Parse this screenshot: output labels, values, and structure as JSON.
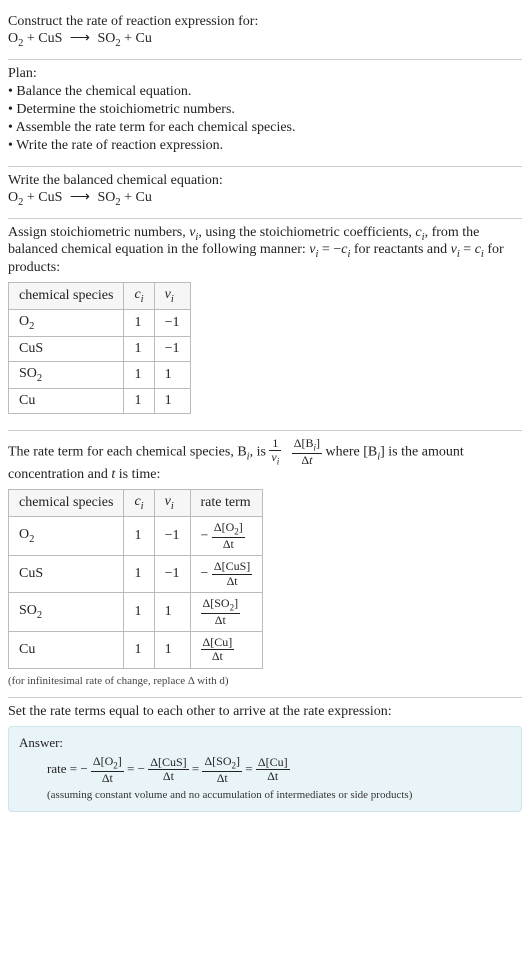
{
  "intro": {
    "construct": "Construct the rate of reaction expression for:",
    "eq_lhs_1": "O",
    "eq_lhs_1_sub": "2",
    "plus": " + ",
    "eq_lhs_2": "CuS",
    "arrow": "⟶",
    "eq_rhs_1": "SO",
    "eq_rhs_1_sub": "2",
    "eq_rhs_2": "Cu"
  },
  "plan": {
    "title": "Plan:",
    "b1": "• Balance the chemical equation.",
    "b2": "• Determine the stoichiometric numbers.",
    "b3": "• Assemble the rate term for each chemical species.",
    "b4": "• Write the rate of reaction expression."
  },
  "balanced": {
    "title": "Write the balanced chemical equation:"
  },
  "assign": {
    "text1": "Assign stoichiometric numbers, ",
    "nu_i": "ν",
    "text2": ", using the stoichiometric coefficients, ",
    "c_i": "c",
    "text3": ", from the balanced chemical equation in the following manner: ",
    "rel1a": "ν",
    "rel1b": " = −",
    "rel1c": "c",
    "text4": " for reactants and ",
    "rel2a": "ν",
    "rel2b": " = ",
    "rel2c": "c",
    "text5": " for products:"
  },
  "table1": {
    "h1": "chemical species",
    "h2": "c",
    "h3": "ν",
    "r1c1": "O",
    "r1c1sub": "2",
    "r1c2": "1",
    "r1c3": "−1",
    "r2c1": "CuS",
    "r2c2": "1",
    "r2c3": "−1",
    "r3c1": "SO",
    "r3c1sub": "2",
    "r3c2": "1",
    "r3c3": "1",
    "r4c1": "Cu",
    "r4c2": "1",
    "r4c3": "1"
  },
  "rateterm": {
    "t1": "The rate term for each chemical species, B",
    "t2": ", is ",
    "frac1_num": "1",
    "frac1_den_a": "ν",
    "frac2_num_a": "Δ[B",
    "frac2_num_b": "]",
    "frac2_den_a": "Δ",
    "frac2_den_b": "t",
    "t3": " where [B",
    "t4": "] is the amount concentration and ",
    "t5": "t",
    "t6": " is time:"
  },
  "table2": {
    "h1": "chemical species",
    "h2": "c",
    "h3": "ν",
    "h4": "rate term",
    "r1c1": "O",
    "r1c1sub": "2",
    "r1c2": "1",
    "r1c3": "−1",
    "r1rt_num": "Δ[O",
    "r1rt_numsub": "2",
    "r1rt_numend": "]",
    "r1rt_den": "Δt",
    "r1rt_sign": "−",
    "r2c1": "CuS",
    "r2c2": "1",
    "r2c3": "−1",
    "r2rt_num": "Δ[CuS]",
    "r2rt_den": "Δt",
    "r2rt_sign": "−",
    "r3c1": "SO",
    "r3c1sub": "2",
    "r3c2": "1",
    "r3c3": "1",
    "r3rt_num": "Δ[SO",
    "r3rt_numsub": "2",
    "r3rt_numend": "]",
    "r3rt_den": "Δt",
    "r4c1": "Cu",
    "r4c2": "1",
    "r4c3": "1",
    "r4rt_num": "Δ[Cu]",
    "r4rt_den": "Δt",
    "note": "(for infinitesimal rate of change, replace Δ with d)"
  },
  "setequal": "Set the rate terms equal to each other to arrive at the rate expression:",
  "answer": {
    "label": "Answer:",
    "rate": "rate = ",
    "neg": "−",
    "eq": " = ",
    "f1num": "Δ[O",
    "f1numsub": "2",
    "f1numend": "]",
    "f1den": "Δt",
    "f2num": "Δ[CuS]",
    "f2den": "Δt",
    "f3num": "Δ[SO",
    "f3numsub": "2",
    "f3numend": "]",
    "f3den": "Δt",
    "f4num": "Δ[Cu]",
    "f4den": "Δt",
    "assume": "(assuming constant volume and no accumulation of intermediates or side products)"
  },
  "sub_i": "i"
}
